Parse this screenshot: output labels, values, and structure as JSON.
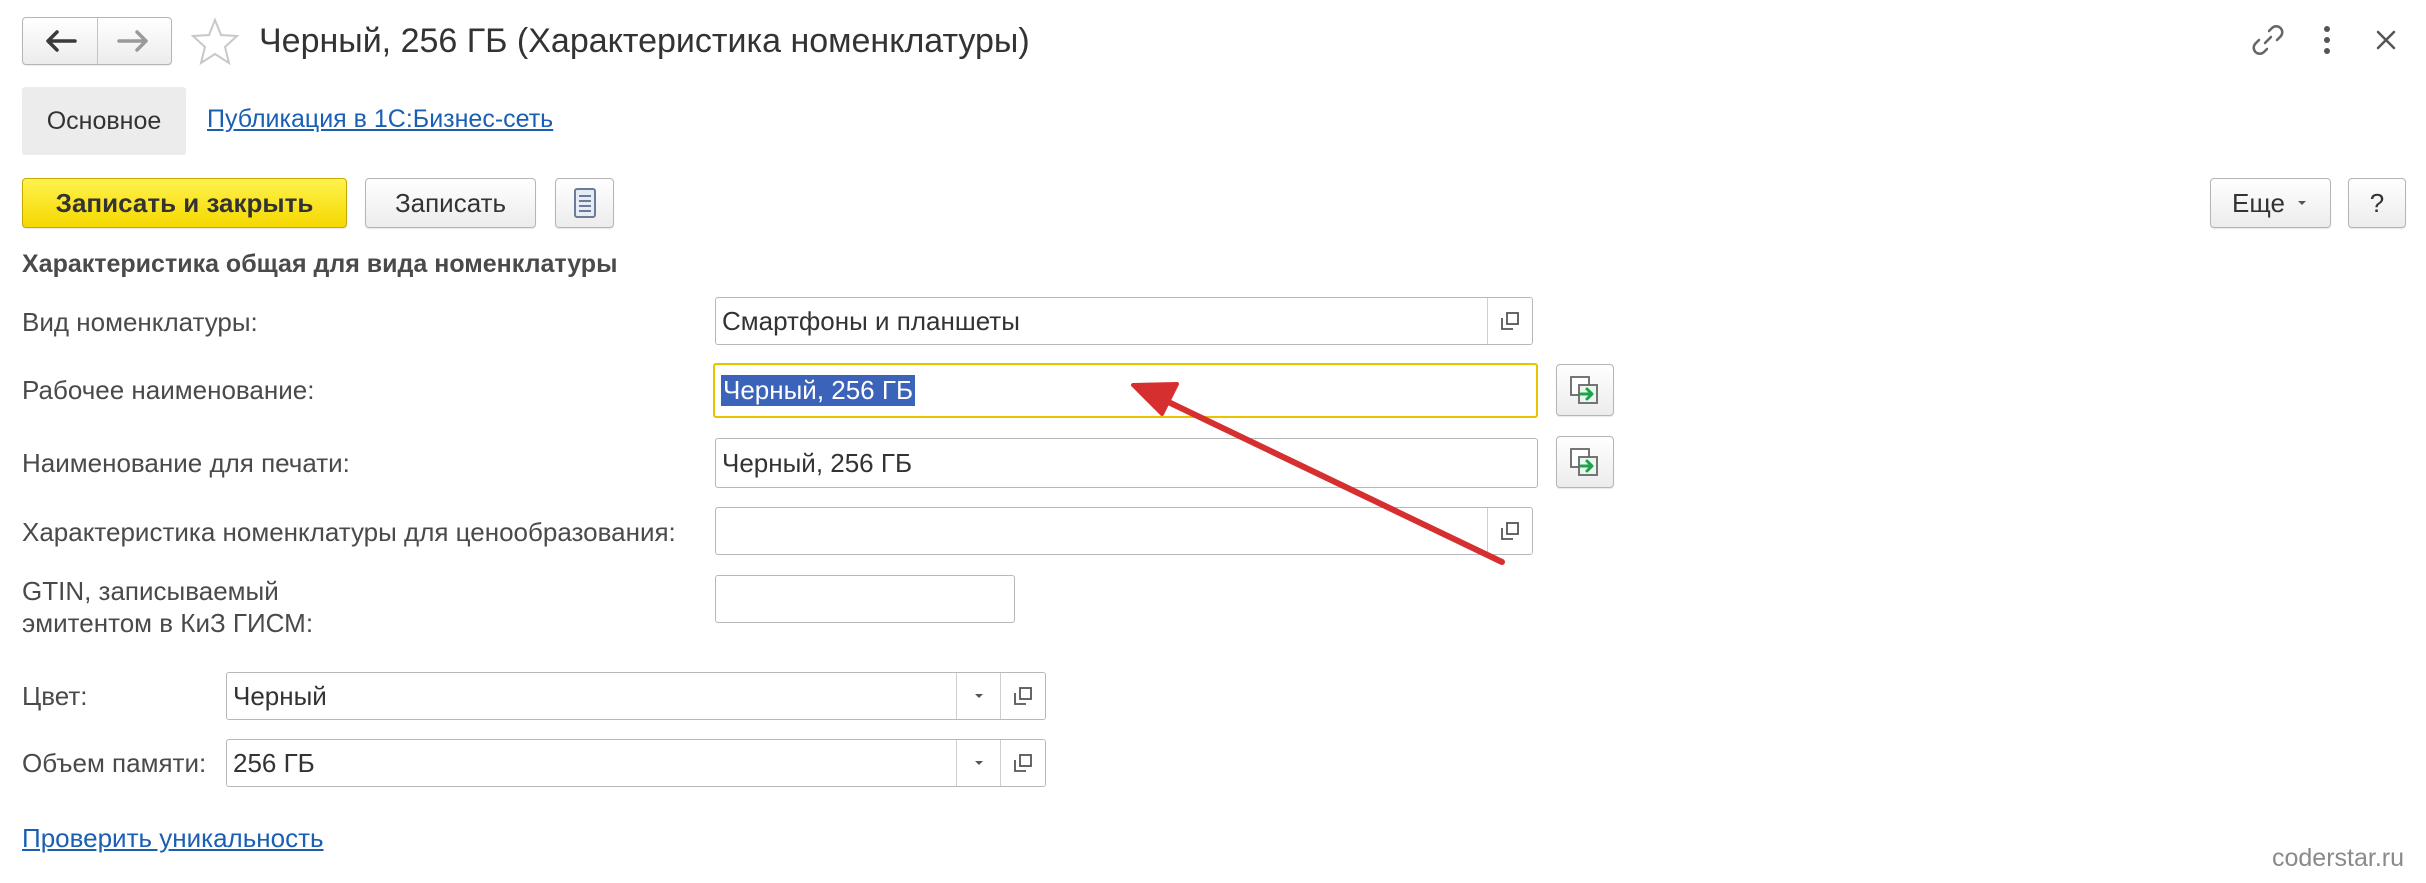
{
  "window": {
    "title": "Черный, 256 ГБ (Характеристика номенклатуры)",
    "icons": [
      "back-arrow-icon",
      "forward-arrow-icon",
      "star-icon",
      "link-icon",
      "more-vertical-icon",
      "close-icon"
    ]
  },
  "tabs": [
    {
      "label": "Основное",
      "active": true
    },
    {
      "label": "Публикация в 1С:Бизнес-сеть",
      "active": false
    }
  ],
  "toolbar": {
    "save_close_label": "Записать и закрыть",
    "save_label": "Записать",
    "more_label": "Еще",
    "help_label": "?"
  },
  "form": {
    "section_title": "Характеристика общая для вида номенклатуры",
    "fields": {
      "kind": {
        "label": "Вид номенклатуры:",
        "value": "Смартфоны и планшеты"
      },
      "working_name": {
        "label": "Рабочее наименование:",
        "value": "Черный, 256 ГБ"
      },
      "print_name": {
        "label": "Наименование для печати:",
        "value": "Черный, 256 ГБ"
      },
      "pricing_char": {
        "label": "Характеристика номенклатуры для ценообразования:",
        "value": ""
      },
      "gtin": {
        "label_line1": "GTIN, записываемый",
        "label_line2": "эмитентом в КиЗ ГИСМ:",
        "value": ""
      },
      "color": {
        "label": "Цвет:",
        "value": "Черный"
      },
      "memory": {
        "label": "Объем памяти:",
        "value": "256 ГБ"
      }
    },
    "check_link": "Проверить уникальность"
  },
  "annotation": {
    "arrow_color": "#d62f2f"
  },
  "colors": {
    "accent_yellow": "#f5d800",
    "link": "#1a5fb4",
    "focus_border": "#e8c400",
    "selection": "#3b63b9"
  },
  "watermark": "coderstar.ru"
}
